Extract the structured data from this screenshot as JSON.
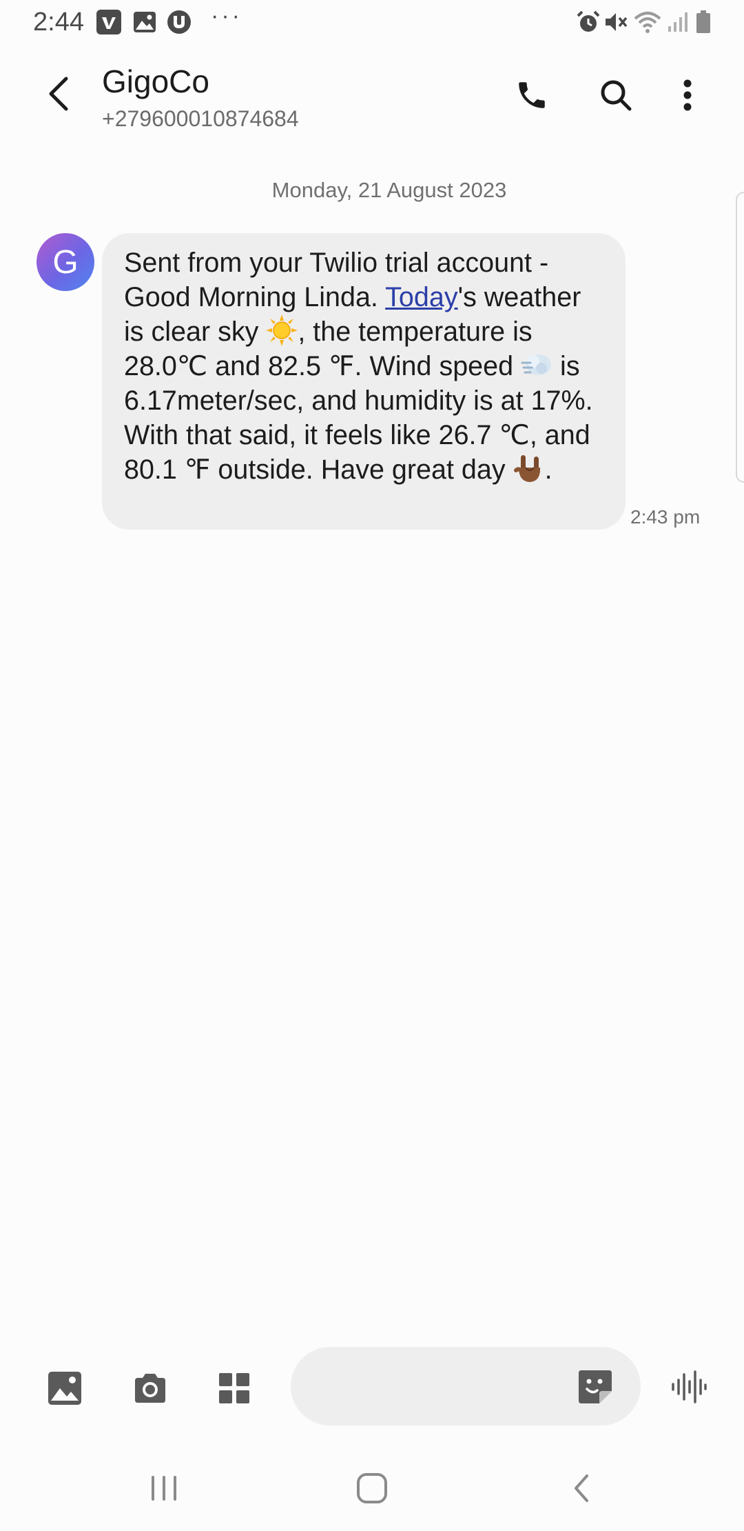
{
  "status_bar": {
    "time": "2:44",
    "overflow": "···",
    "left_icons": [
      "vimeo-icon",
      "image-notification-icon",
      "torrent-icon"
    ],
    "right_icons": [
      "alarm-icon",
      "mute-icon",
      "wifi-icon",
      "signal-icon",
      "battery-icon"
    ]
  },
  "header": {
    "contact_name": "GigoCo",
    "contact_number": "+279600010874684",
    "icons": [
      "back-arrow-icon",
      "phone-icon",
      "search-icon",
      "more-vertical-icon"
    ]
  },
  "conversation": {
    "date": "Monday, 21 August 2023",
    "avatar_letter": "G",
    "message": {
      "part1": "Sent from your Twilio trial account - Good Morning Linda. ",
      "link": "Today",
      "part2": "'s weather is clear sky ",
      "part3": ", the temperature is 28.0℃ and 82.5 ℉. Wind speed ",
      "part4": " is 6.17meter/sec, and humidity is at 17%. With that said, it feels like 26.7 ℃, and 80.1 ℉ outside. Have great day ",
      "part5": ".",
      "emojis": [
        "sun-emoji",
        "wind-emoji",
        "rock-on-hand-emoji"
      ],
      "time": "2:43 pm"
    }
  },
  "composer": {
    "input_value": "",
    "icons": [
      "gallery-icon",
      "camera-icon",
      "apps-grid-icon",
      "sticker-icon",
      "voice-waveform-icon"
    ]
  },
  "nav_bar": {
    "icons": [
      "recents-icon",
      "home-icon",
      "nav-back-icon"
    ]
  },
  "colors": {
    "background": "#fdfcfc",
    "bubble": "#efeeee",
    "link": "#2b3ea8",
    "avatar_start": "#b05bd0",
    "avatar_end": "#4f86ee"
  }
}
